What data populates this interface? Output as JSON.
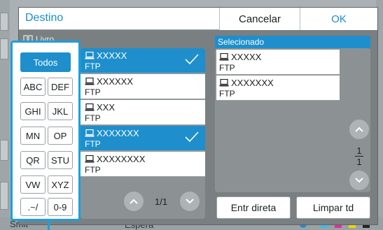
{
  "dialog": {
    "title": "Destino",
    "cancel_label": "Cancelar",
    "ok_label": "OK"
  },
  "book_section": {
    "label": "Livro",
    "icon": "book-icon"
  },
  "selected_section": {
    "label": "Selecionado"
  },
  "index_keys": [
    "Todos",
    "ABC",
    "DEF",
    "GHI",
    "JKL",
    "MN",
    "OP",
    "QR",
    "STU",
    "VW",
    "XYZ",
    ".~/",
    "0-9"
  ],
  "address_list": [
    {
      "name": "XXXXX",
      "type": "FTP",
      "selected": true
    },
    {
      "name": "XXXXXX",
      "type": "FTP",
      "selected": false
    },
    {
      "name": "XXX",
      "type": "FTP",
      "selected": false
    },
    {
      "name": "XXXXXXX",
      "type": "FTP",
      "selected": true
    },
    {
      "name": "XXXXXXXX",
      "type": "FTP",
      "selected": false
    }
  ],
  "address_pager": {
    "page": "1/1"
  },
  "selected_list": [
    {
      "name": "XXXXX",
      "type": "FTP"
    },
    {
      "name": "XXXXXXX",
      "type": "FTP"
    }
  ],
  "selected_pager": {
    "current": "1",
    "total": "1"
  },
  "actions": {
    "direct_entry": "Entr direta",
    "clear_all": "Limpar td"
  },
  "background": {
    "status_left": "Smit",
    "status_mid": "Espera"
  },
  "colors": {
    "accent": "#1e8fcc",
    "highlight": "#1aa0de"
  }
}
